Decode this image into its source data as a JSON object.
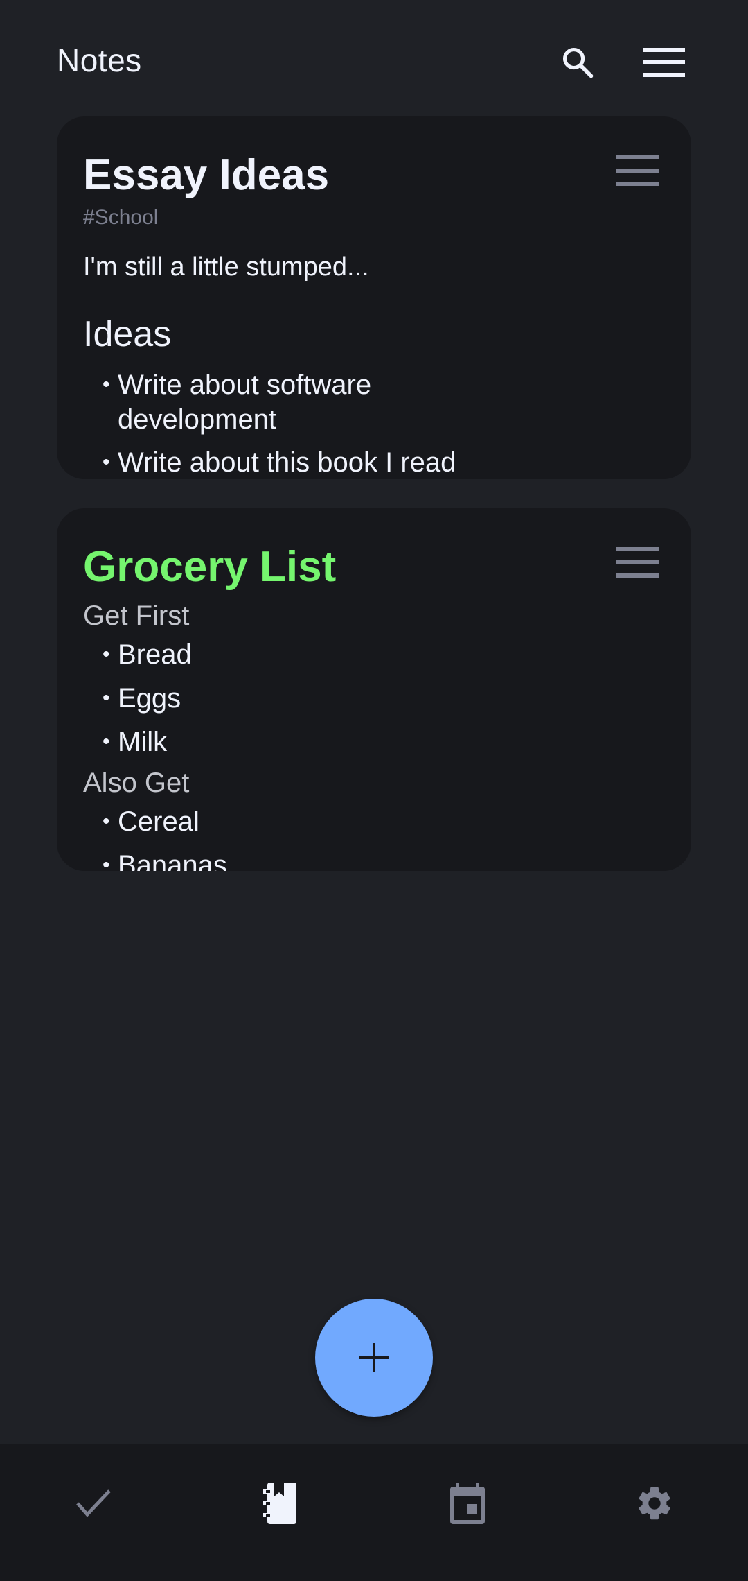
{
  "header": {
    "title": "Notes",
    "search_icon": "search-icon",
    "menu_icon": "menu-icon"
  },
  "notes": [
    {
      "title": "Essay Ideas",
      "title_color": "#f0f3fc",
      "tag": "#School",
      "paragraph": "I'm still a little stumped...",
      "heading": "Ideas",
      "bullets": [
        "Write about software development",
        "Write about this book I read"
      ]
    },
    {
      "title": "Grocery List",
      "title_color": "#75f56e",
      "sections": [
        {
          "heading": "Get First",
          "items": [
            "Bread",
            "Eggs",
            "Milk"
          ]
        },
        {
          "heading": "Also Get",
          "items": [
            "Cereal",
            "Bananas"
          ]
        }
      ]
    }
  ],
  "fab": {
    "icon": "plus-icon",
    "color": "#71a9fe"
  },
  "bottom_nav": {
    "items": [
      {
        "name": "tasks",
        "icon": "check-icon",
        "active": false
      },
      {
        "name": "notes",
        "icon": "notebook-icon",
        "active": true
      },
      {
        "name": "calendar",
        "icon": "calendar-icon",
        "active": false
      },
      {
        "name": "settings",
        "icon": "gear-icon",
        "active": false
      }
    ]
  },
  "colors": {
    "background": "#1f2126",
    "card": "#17181c",
    "text": "#f0f3fc",
    "muted": "#7d8090",
    "accent": "#71a9fe",
    "green": "#75f56e"
  }
}
